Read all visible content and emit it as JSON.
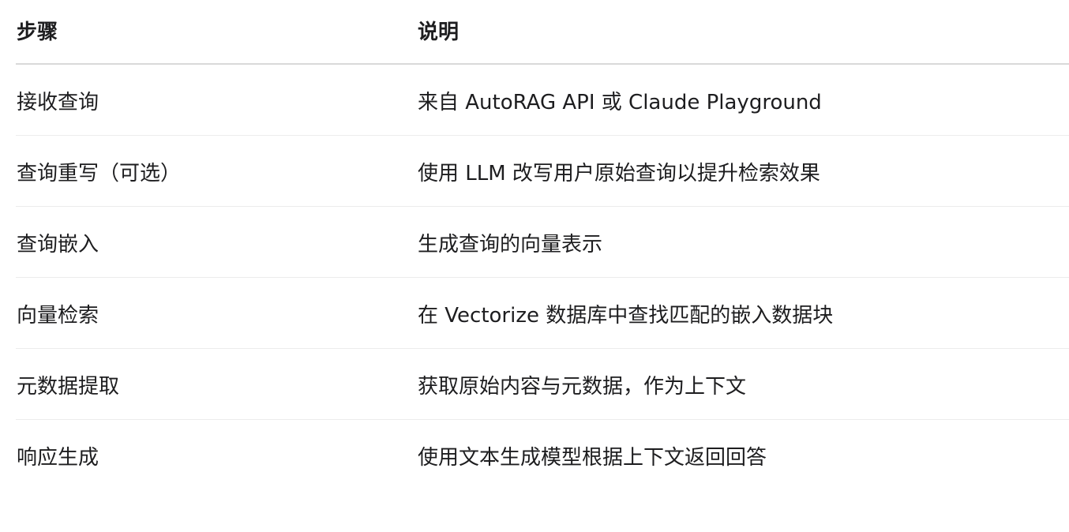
{
  "table": {
    "headers": {
      "step": "步骤",
      "description": "说明"
    },
    "rows": [
      {
        "step": "接收查询",
        "description": "来自 AutoRAG API 或 Claude Playground"
      },
      {
        "step": "查询重写（可选）",
        "description": "使用 LLM 改写用户原始查询以提升检索效果"
      },
      {
        "step": "查询嵌入",
        "description": "生成查询的向量表示"
      },
      {
        "step": "向量检索",
        "description": "在 Vectorize 数据库中查找匹配的嵌入数据块"
      },
      {
        "step": "元数据提取",
        "description": "获取原始内容与元数据，作为上下文"
      },
      {
        "step": "响应生成",
        "description": "使用文本生成模型根据上下文返回回答"
      }
    ]
  }
}
